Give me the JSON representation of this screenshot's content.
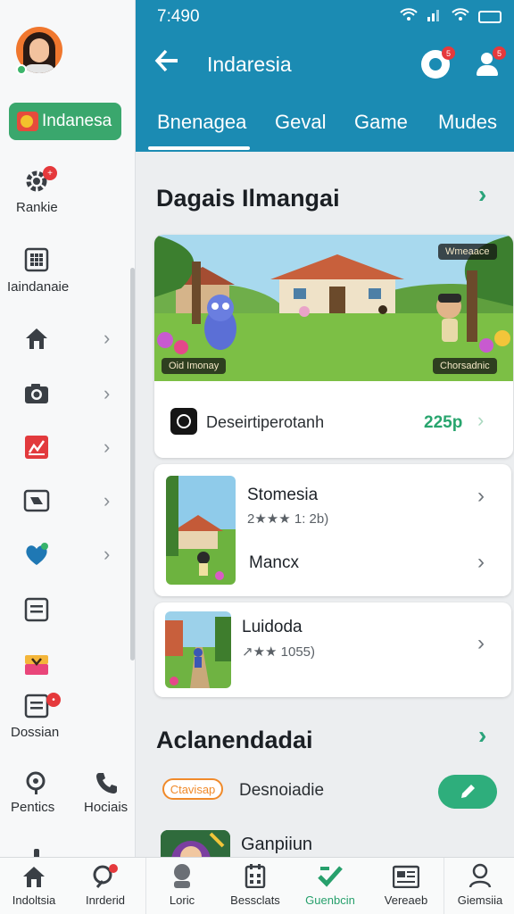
{
  "status_bar": {
    "time": "7:490",
    "battery": ""
  },
  "header": {
    "title": "Indaresia",
    "notif_badge": "5",
    "profile_badge": "5"
  },
  "tabs": [
    {
      "label": "Bnenagea",
      "active": true
    },
    {
      "label": "Geval",
      "active": false
    },
    {
      "label": "Game",
      "active": false
    },
    {
      "label": "Mudes",
      "active": false
    }
  ],
  "sidebar": {
    "language": "Indanesa",
    "items": [
      {
        "label": "Rankie",
        "icon": "gear-icon"
      },
      {
        "label": "Iaindanaie",
        "icon": "grid-icon"
      },
      {
        "label": "",
        "icon": "home-icon"
      },
      {
        "label": "",
        "icon": "camera-icon"
      },
      {
        "label": "",
        "icon": "chart-icon"
      },
      {
        "label": "",
        "icon": "media-icon"
      },
      {
        "label": "",
        "icon": "heart-shield-icon"
      },
      {
        "label": "",
        "icon": "document-icon"
      },
      {
        "label": "",
        "icon": "flag-icon"
      },
      {
        "label": "Dossian",
        "icon": "list-icon"
      },
      {
        "label": "Pentics",
        "icon": "search-icon"
      },
      {
        "label": "Hociais",
        "icon": "phone-icon"
      }
    ]
  },
  "section1": {
    "title": "Dagais Ilmangai",
    "banner_tag_left": "Oid Imonay",
    "banner_tag_right": "Chorsadnic",
    "banner_tag_top": "Wmeaace",
    "desc": "Deseirtiperotanh",
    "price": "225p"
  },
  "items": [
    {
      "title": "Stomesia",
      "rating": "2★★★ 1: 2b)",
      "subtitle": "Mancx"
    },
    {
      "title": "Luidoda",
      "rating": "↗★★ 1055)"
    }
  ],
  "section2": {
    "title": "Aclanendadai",
    "tag": "Ctavisap",
    "desc": "Desnoiadie",
    "last_item": "Ganpiiun"
  },
  "bottom_nav": [
    {
      "label": "Indoltsia",
      "icon": "home-icon",
      "active": false
    },
    {
      "label": "Inrderid",
      "icon": "search-icon",
      "active": false
    },
    {
      "label": "Loric",
      "icon": "avatar-icon",
      "active": false
    },
    {
      "label": "Bessclats",
      "icon": "calendar-icon",
      "active": false
    },
    {
      "label": "Guenbcin",
      "icon": "check-icon",
      "active": true
    },
    {
      "label": "Vereaeb",
      "icon": "newspaper-icon",
      "active": false
    },
    {
      "label": "Giemsiia",
      "icon": "profile-icon",
      "active": false
    }
  ],
  "colors": {
    "header": "#1b8bb3",
    "accent": "#2eae7c",
    "badge": "#e5393c",
    "tag": "#f08a2a"
  }
}
